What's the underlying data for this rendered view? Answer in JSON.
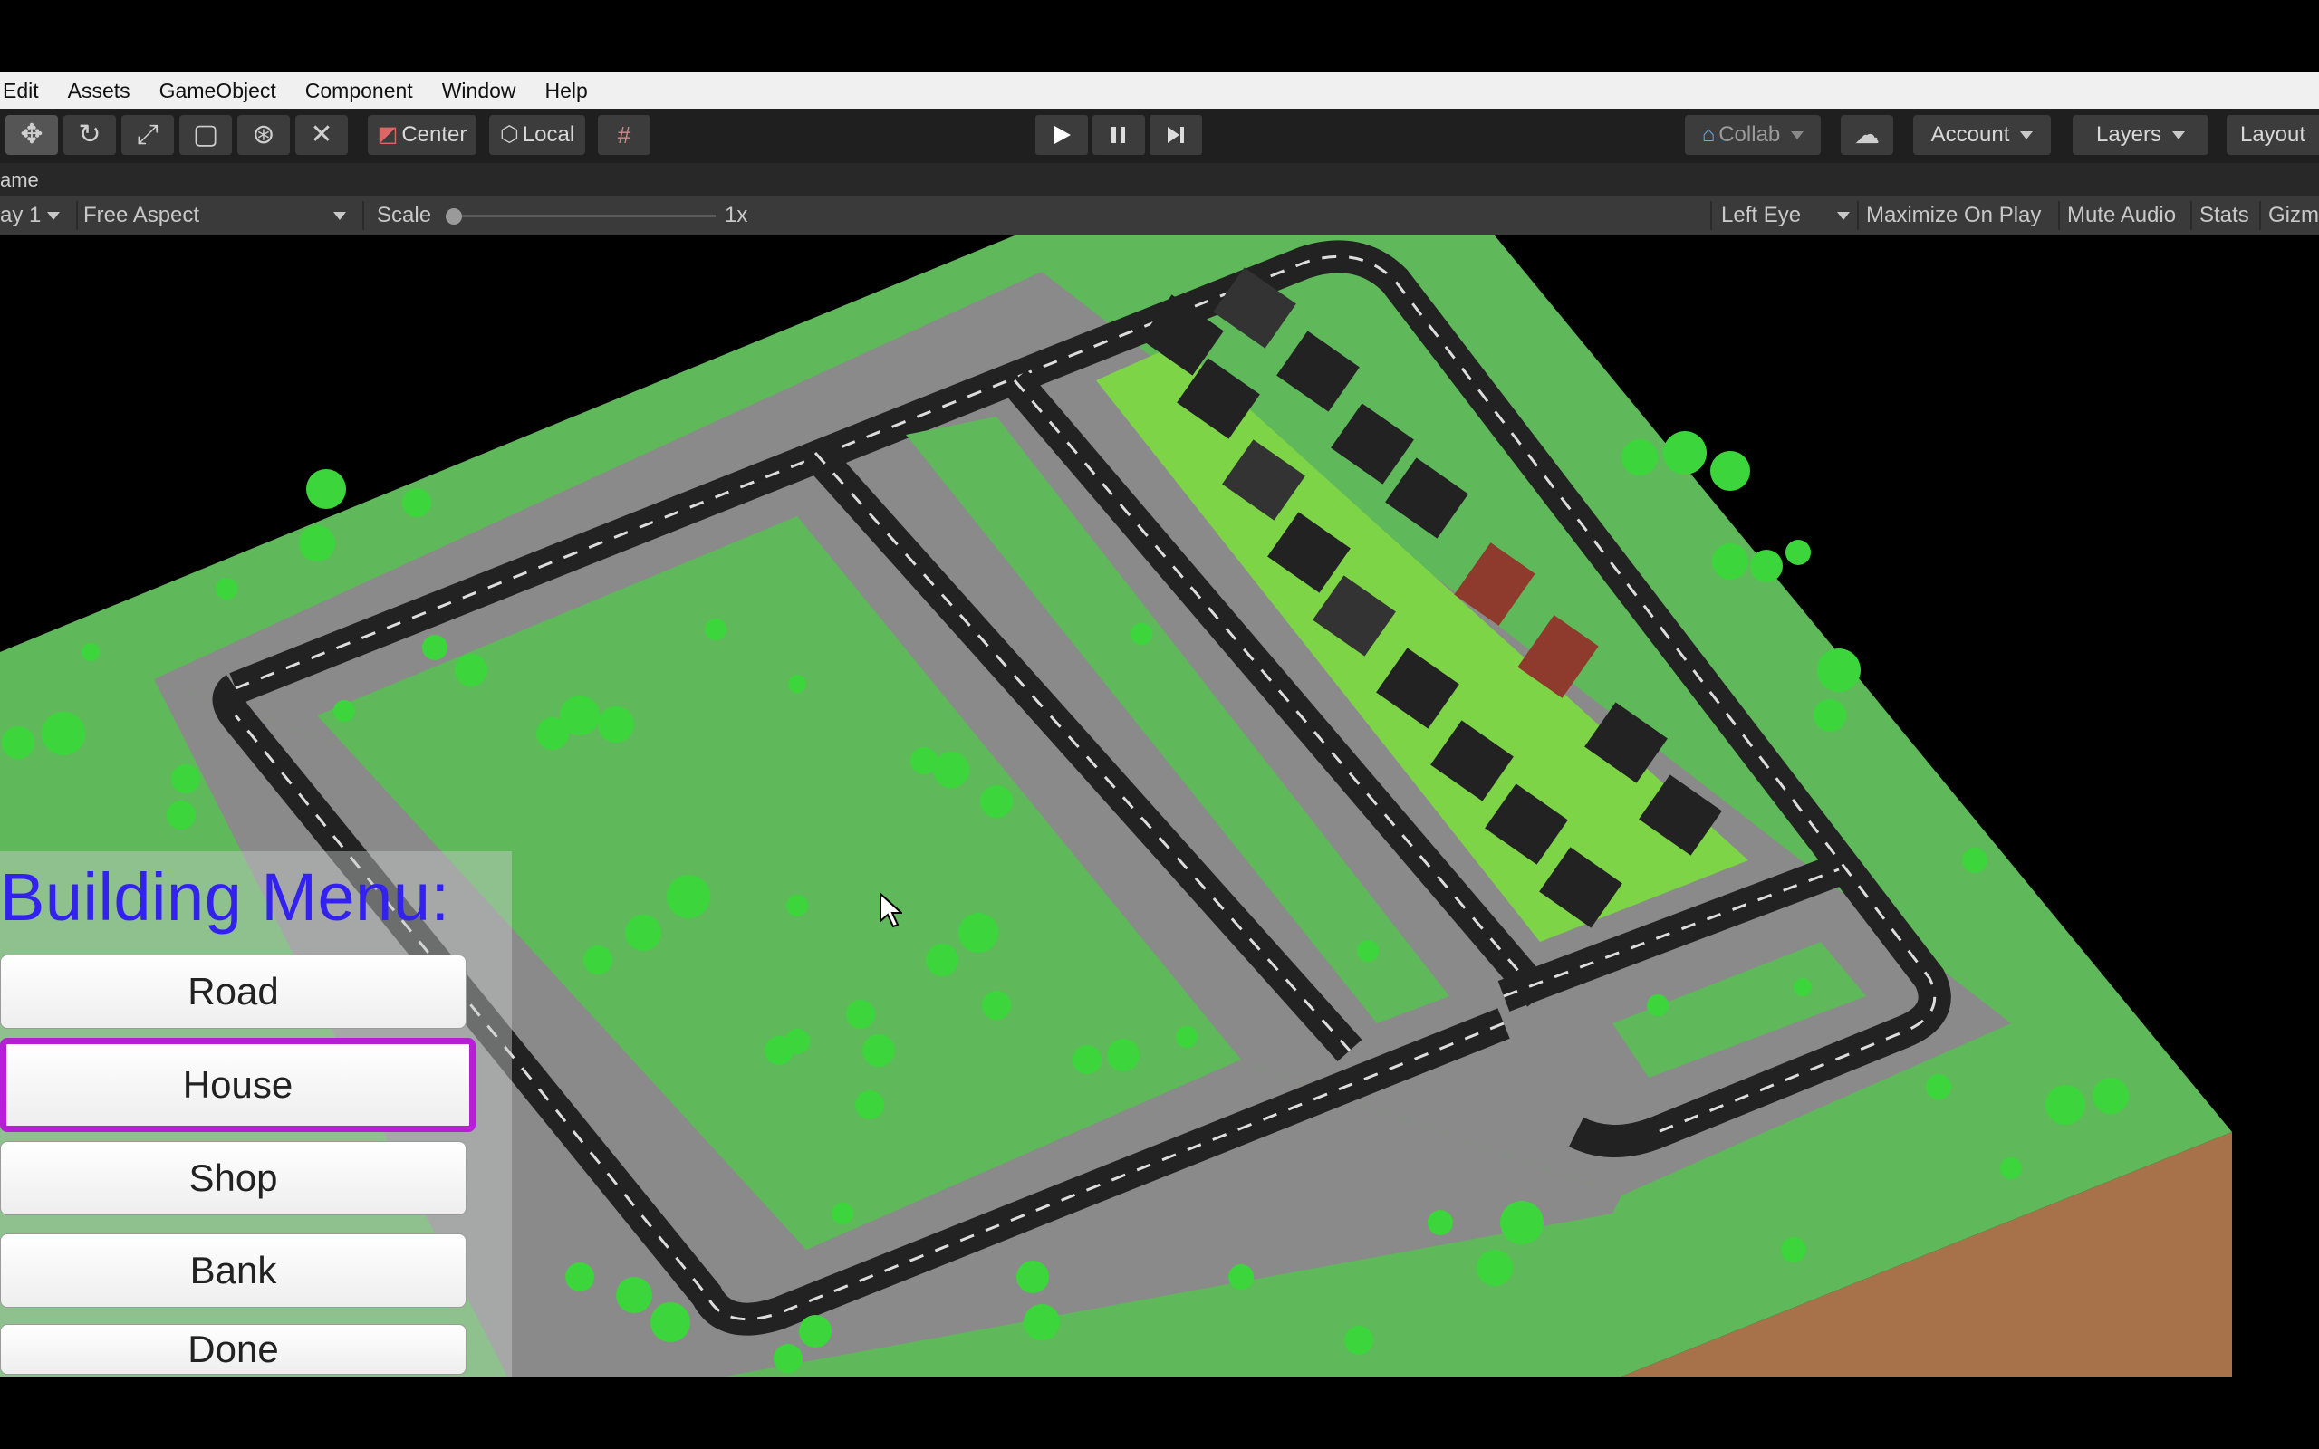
{
  "menu": [
    "Edit",
    "Assets",
    "GameObject",
    "Component",
    "Window",
    "Help"
  ],
  "toolbar": {
    "pivot_label": "Center",
    "space_label": "Local",
    "collab_label": "Collab",
    "account_label": "Account",
    "layers_label": "Layers",
    "layout_label": "Layout"
  },
  "game_tab": {
    "title": "ame"
  },
  "game_bar": {
    "display": "ay 1",
    "aspect": "Free Aspect",
    "scale_label": "Scale",
    "scale_value": "1x",
    "eye": "Left Eye",
    "maximize": "Maximize On Play",
    "mute": "Mute Audio",
    "stats": "Stats",
    "gizmos": "Gizm"
  },
  "building_menu": {
    "title": "Building Menu:",
    "buttons": [
      "Road",
      "House",
      "Shop",
      "Bank",
      "Done"
    ],
    "selected": "House"
  },
  "colors": {
    "grass": "#5fb85a",
    "road": "#222222",
    "sidewalk": "#8a8a8a",
    "tree": "#3cd63c",
    "dirt": "#a7714a",
    "highlight": "#b61fd6",
    "menu_title": "#3322ee"
  }
}
